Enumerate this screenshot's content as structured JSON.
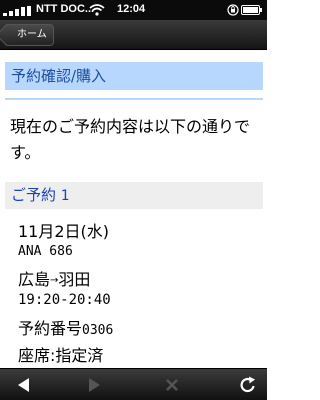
{
  "status_bar": {
    "carrier": "NTT DOC...",
    "time": "12:04"
  },
  "nav": {
    "back_label": "ホーム"
  },
  "page": {
    "heading": "予約確認/購入",
    "intro": "現在のご予約内容は以下の通りです。"
  },
  "reservation": {
    "section_label": "ご予約",
    "number": "1",
    "date": "11月2日(水)",
    "flight": "ANA 686",
    "origin": "広島",
    "destination": "羽田",
    "times": "19:20-20:40",
    "booking_label": "予約番号",
    "booking_number": "0306",
    "seat": "座席:指定済"
  },
  "icons": {
    "status": [
      "signal-icon",
      "wifi-icon",
      "orientation-lock-icon",
      "battery-icon"
    ],
    "toolbar": [
      "back-arrow-icon",
      "forward-arrow-icon",
      "stop-icon",
      "reload-icon"
    ]
  },
  "colors": {
    "heading_bg": "#b7d7ff",
    "heading_text": "#1f4fa0",
    "section_bg": "#eeeeee",
    "section_text": "#1a43b8"
  }
}
